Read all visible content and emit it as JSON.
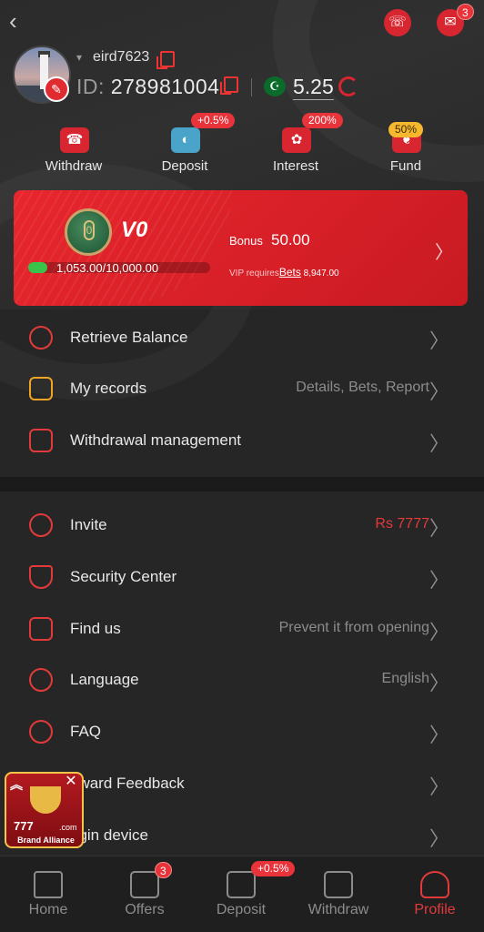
{
  "header": {
    "back_label": "‹",
    "notification_badge": "3",
    "username": "eird7623",
    "id_label": "ID:",
    "id_value": "278981004",
    "currency_flag": "☪",
    "balance": "5.25"
  },
  "actions": [
    {
      "label": "Withdraw",
      "icon": "withdraw-icon",
      "glyph": "☎",
      "badge": ""
    },
    {
      "label": "Deposit",
      "icon": "wallet-icon",
      "glyph": "◐",
      "badge": "+0.5%"
    },
    {
      "label": "Interest",
      "icon": "piggy-bank-icon",
      "glyph": "✿",
      "badge": "200%"
    },
    {
      "label": "Fund",
      "icon": "fund-icon",
      "glyph": "❦",
      "badge": "50%"
    }
  ],
  "vip": {
    "medal_level": "0",
    "level": "V0",
    "progress_text": "1,053.00/10,000.00",
    "progress_fraction": 0.1053,
    "bonus_label": "Bonus",
    "bonus_value": "50.00",
    "requires_prefix": "VIP requires",
    "requires_link": "Bets",
    "requires_value": "8,947.00"
  },
  "menu_section_1": [
    {
      "label": "Retrieve Balance",
      "value": "",
      "icon": "retrieve-balance-icon"
    },
    {
      "label": "My records",
      "value": "Details, Bets, Report",
      "icon": "records-icon"
    },
    {
      "label": "Withdrawal management",
      "value": "",
      "icon": "withdrawal-management-icon"
    }
  ],
  "menu_section_2": [
    {
      "label": "Invite",
      "value": "Rs 7777",
      "icon": "invite-icon"
    },
    {
      "label": "Security Center",
      "value": "",
      "icon": "shield-icon"
    },
    {
      "label": "Find us",
      "value": "Prevent it from opening",
      "icon": "find-us-icon"
    },
    {
      "label": "Language",
      "value": "English",
      "icon": "globe-icon"
    },
    {
      "label": "FAQ",
      "value": "",
      "icon": "question-icon"
    },
    {
      "label": "eward Feedback",
      "value": "",
      "icon": "feedback-icon"
    },
    {
      "label": "ogin device",
      "value": "",
      "icon": "device-icon"
    }
  ],
  "promo": {
    "brand": "777",
    "brand_suffix": ".com",
    "label": "Brand Alliance",
    "close": "✕",
    "up": "︽"
  },
  "bottom_nav": [
    {
      "label": "Home",
      "badge": "",
      "active": false
    },
    {
      "label": "Offers",
      "badge": "3",
      "active": false
    },
    {
      "label": "Deposit",
      "badge": "+0.5%",
      "active": false
    },
    {
      "label": "Withdraw",
      "badge": "",
      "active": false
    },
    {
      "label": "Profile",
      "badge": "",
      "active": true
    }
  ],
  "colors": {
    "accent": "#e23a3a",
    "background": "#262626",
    "vip_card": "#e8262d",
    "progress": "#3ac24a"
  }
}
